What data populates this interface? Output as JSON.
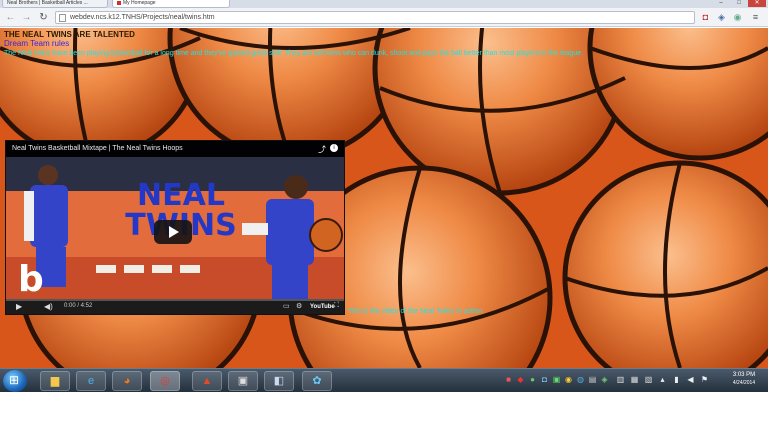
{
  "browser": {
    "tabs": [
      {
        "label": "Neal Brothers | Basketball Articles ..."
      },
      {
        "label": "My Homepage"
      }
    ],
    "url": "webdev.ncs.k12.TNHS/Projects/neal/twins.htm",
    "window_controls": {
      "minimize": "–",
      "maximize": "□",
      "close": "✕"
    }
  },
  "page": {
    "title": "THE NEAL TWINS ARE TALENTED",
    "subtitle": "Dream Team rules",
    "body": "The Neal twins have been playing basketball for a long time and they've gained great skill. They are tall twins who can dunk, shoot and pass the ball better than most players in the league.",
    "background_color": "#e8641d",
    "text_color_cyan": "#17e6e8",
    "subtitle_color": "#3a25e0"
  },
  "video": {
    "title": "Neal Twins Basketball Mixtape | The Neal Twins Hoops",
    "overlay_text": "NEAL TWINS",
    "channel_logo": "b",
    "time": "0:00 / 4:52",
    "youtube_label": "YouTube",
    "progress": 0.0,
    "icons": {
      "play": "play-icon",
      "volume": "volume-icon",
      "share": "share-icon",
      "info": "info-icon",
      "settings": "gear-icon",
      "fullscreen": "fullscreen-icon"
    }
  },
  "caption": "This is the video of the Neal Twins in action",
  "taskbar": {
    "apps": [
      "explorer",
      "internet-explorer",
      "firefox",
      "chrome",
      "acrobat",
      "photos",
      "media-player",
      "windows-live"
    ],
    "clock_time": "3:03 PM",
    "clock_date": "4/24/2014"
  }
}
